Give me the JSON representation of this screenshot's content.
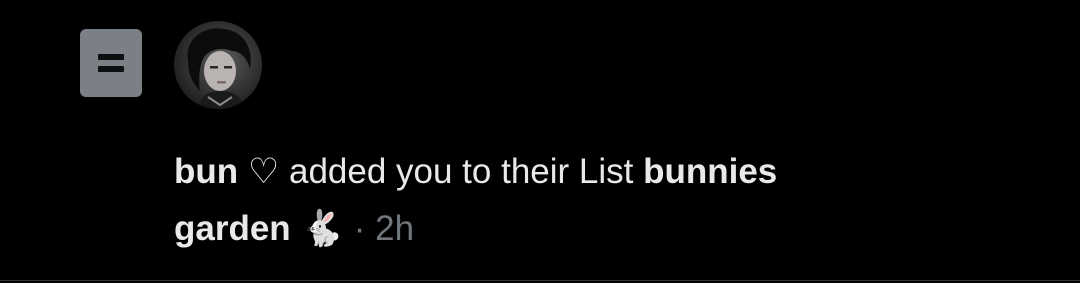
{
  "notification": {
    "actor_name": "bun ♡",
    "action_text": " added you to their List ",
    "list_name_part1": "bunnies",
    "list_name_part2": "garden",
    "list_emoji": "🐇",
    "separator": " · ",
    "time_ago": "2h",
    "icon": "list-icon",
    "avatar_icon": "user-avatar"
  },
  "colors": {
    "background": "#000000",
    "text": "#e7e9ea",
    "muted": "#71767b",
    "list_icon_bg": "#7a8086"
  }
}
